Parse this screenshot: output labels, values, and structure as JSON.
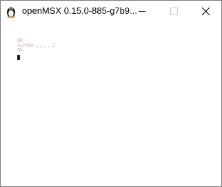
{
  "window": {
    "title": "openMSX 0.15.0-885-g7b9...",
    "app_icon": "openmsx-penguin-icon",
    "controls": {
      "minimize_icon": "minimize-icon",
      "maximize_icon": "maximize-icon",
      "close_icon": "close-icon"
    }
  },
  "screen": {
    "lines": [
      "Ok",
      "screen ,,,,,,1",
      "Ok"
    ],
    "text_color": "#c8a8a8",
    "cursor_color": "#1a1a1a",
    "background_color": "#ffffff"
  }
}
